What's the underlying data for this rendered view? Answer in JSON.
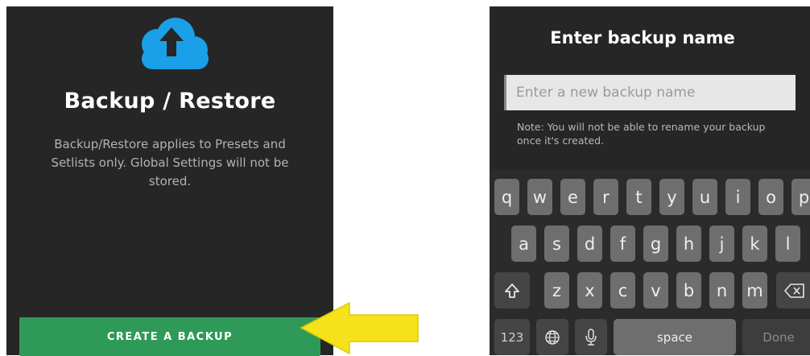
{
  "backup_screen": {
    "title": "Backup / Restore",
    "description": "Backup/Restore applies to Presets and Setlists only. Global Settings will not be stored.",
    "create_button_label": "CREATE A BACKUP",
    "icon": "cloud-upload-icon",
    "accent_color": "#1aa0e8",
    "button_color": "#2f9a57"
  },
  "pointer_arrow": {
    "icon": "arrow-left-icon",
    "color": "#f6e21a"
  },
  "name_dialog": {
    "title": "Enter backup name",
    "input_placeholder": "Enter a new backup name",
    "input_value": "",
    "note": "Note: You will not be able to rename your backup once it's created."
  },
  "keyboard": {
    "row1": [
      "q",
      "w",
      "e",
      "r",
      "t",
      "y",
      "u",
      "i",
      "o",
      "p"
    ],
    "row2": [
      "a",
      "s",
      "d",
      "f",
      "g",
      "h",
      "j",
      "k",
      "l"
    ],
    "row3": [
      "z",
      "x",
      "c",
      "v",
      "b",
      "n",
      "m"
    ],
    "numbers_label": "123",
    "space_label": "space",
    "done_label": "Done",
    "shift_icon": "shift-icon",
    "backspace_icon": "backspace-icon",
    "globe_icon": "globe-icon",
    "mic_icon": "microphone-icon"
  }
}
